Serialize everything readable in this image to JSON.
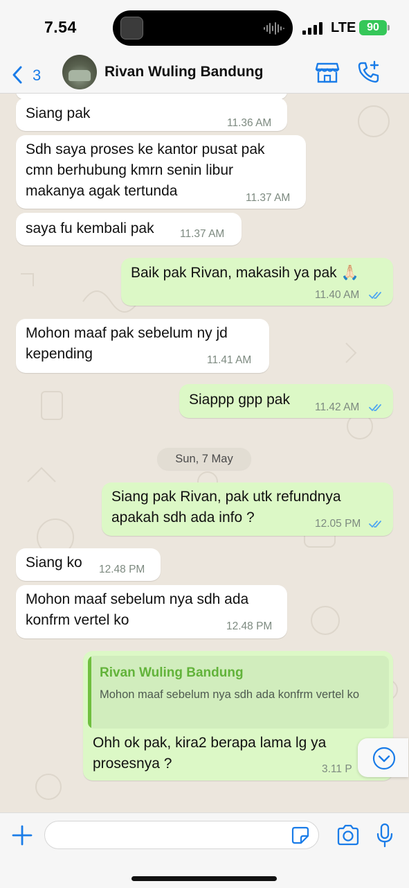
{
  "status_bar": {
    "time": "7.54",
    "network": "LTE",
    "battery": "90"
  },
  "header": {
    "back_count": "3",
    "contact_name": "Rivan Wuling Bandung"
  },
  "messages": [
    {
      "dir": "in",
      "lines": [
        "Siang pak"
      ],
      "time": "11.36 AM"
    },
    {
      "dir": "in",
      "lines": [
        "Sdh saya proses ke kantor pusat pak",
        "cmn berhubung kmrn senin libur",
        "makanya agak tertunda"
      ],
      "time": "11.37 AM"
    },
    {
      "dir": "in",
      "lines": [
        "saya fu kembali pak"
      ],
      "time": "11.37 AM"
    },
    {
      "dir": "out",
      "lines": [
        "Baik pak Rivan, makasih ya pak 🙏🏻"
      ],
      "time": "11.40 AM",
      "read": true
    },
    {
      "dir": "in",
      "lines": [
        "Mohon maaf pak sebelum ny jd",
        "kepending"
      ],
      "time": "11.41 AM"
    },
    {
      "dir": "out",
      "lines": [
        "Siappp gpp pak"
      ],
      "time": "11.42 AM",
      "read": true
    },
    {
      "dir": "out",
      "lines": [
        "Siang pak Rivan, pak utk refundnya",
        "apakah sdh ada info ?"
      ],
      "time": "12.05 PM",
      "read": true
    },
    {
      "dir": "in",
      "lines": [
        "Siang ko"
      ],
      "time": "12.48 PM"
    },
    {
      "dir": "in",
      "lines": [
        "Mohon maaf sebelum nya sdh ada",
        "konfrm vertel ko"
      ],
      "time": "12.48 PM"
    },
    {
      "dir": "out",
      "lines": [
        "Ohh ok pak, kira2 berapa lama lg ya",
        "prosesnya ?"
      ],
      "time": "3.11 P",
      "reply_to": {
        "name": "Rivan Wuling Bandung",
        "text": "Mohon maaf sebelum nya sdh ada konfrm vertel ko"
      }
    }
  ],
  "day_separator": "Sun, 7 May",
  "composer": {
    "value": ""
  },
  "colors": {
    "accent": "#1a7ce8",
    "outgoing_bubble": "#dcf8c6",
    "incoming_bubble": "#ffffff",
    "read_ticks": "#4fa6f0",
    "reply_name": "#62b33a"
  },
  "icons": [
    "chevron-left-icon",
    "storefront-icon",
    "phone-plus-icon",
    "plus-icon",
    "sticker-icon",
    "camera-icon",
    "microphone-icon",
    "chevron-down-icon",
    "double-check-icon"
  ]
}
